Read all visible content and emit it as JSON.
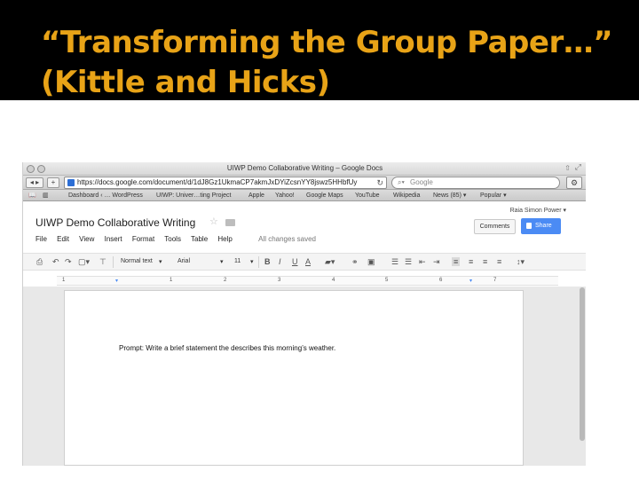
{
  "slide": {
    "title": "“Transforming the Group Paper…” (Kittle and Hicks)",
    "colors": {
      "title": "#e8a317",
      "band": "#000000"
    }
  },
  "browser": {
    "window_title": "UIWP Demo Collaborative Writing – Google Docs",
    "url": "https://docs.google.com/document/d/1dJ8Gz1UkmaCP7akmJxDYiZcsnYY8jswz5HHbfUy",
    "search_placeholder": "Google",
    "bookmarks": [
      "Dashboard ‹ … WordPress",
      "UIWP: Univer…ting Project",
      "Apple",
      "Yahoo!",
      "Google Maps",
      "YouTube",
      "Wikipedia",
      "News (85) ▾",
      "Popular ▾"
    ]
  },
  "doc": {
    "title": "UIWP Demo Collaborative Writing",
    "user": "Raia Simon Power ▾",
    "comments_label": "Comments",
    "share_label": "Share",
    "menu": [
      "File",
      "Edit",
      "View",
      "Insert",
      "Format",
      "Tools",
      "Table",
      "Help"
    ],
    "save_status": "All changes saved",
    "toolbar": {
      "style": "Normal text",
      "font": "Arial",
      "size": "11"
    },
    "ruler_numbers": [
      "1",
      "1",
      "2",
      "3",
      "4",
      "5",
      "6",
      "7"
    ],
    "body_text": "Prompt: Write a brief statement the describes this morning’s weather."
  }
}
